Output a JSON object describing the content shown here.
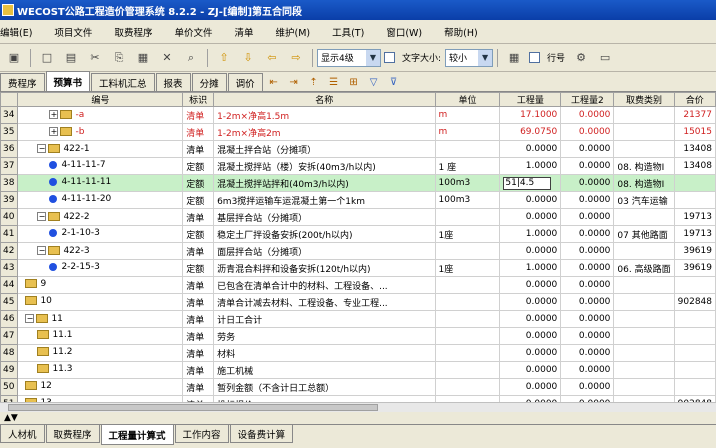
{
  "window": {
    "title": "WECOST公路工程造价管理系统 8.2.2 - ZJ-[编制]第五合同段"
  },
  "menu": [
    "编辑(E)",
    "项目文件",
    "取费程序",
    "单价文件",
    "清单",
    "维护(M)",
    "工具(T)",
    "窗口(W)",
    "帮助(H)"
  ],
  "toolbar": {
    "display_level": "显示4级",
    "font_size_label": "文字大小:",
    "font_size_value": "较小",
    "line_number_label": "行号"
  },
  "tabs": [
    "费程序",
    "预算书",
    "工料机汇总",
    "报表",
    "分摊",
    "调价"
  ],
  "active_tab": 1,
  "columns": [
    "编号",
    "标识",
    "名称",
    "单位",
    "工程量",
    "工程量2",
    "取费类别",
    "合价"
  ],
  "rows": [
    {
      "rn": "34",
      "code": "-a",
      "level": 2,
      "kind": "folder",
      "pm": "+",
      "tag": "清单",
      "name": "1-2m×净高1.5m",
      "unit": "m",
      "qty": "17.1000",
      "qty2": "0.0000",
      "cat": "",
      "total": "21377",
      "red": true
    },
    {
      "rn": "35",
      "code": "-b",
      "level": 2,
      "kind": "folder",
      "pm": "+",
      "tag": "清单",
      "name": "1-2m×净高2m",
      "unit": "m",
      "qty": "69.0750",
      "qty2": "0.0000",
      "cat": "",
      "total": "15015",
      "red": true
    },
    {
      "rn": "36",
      "code": "422-1",
      "level": 1,
      "kind": "folder",
      "pm": "-",
      "tag": "清单",
      "name": "混凝土拌合站（分摊项）",
      "unit": "",
      "qty": "0.0000",
      "qty2": "0.0000",
      "cat": "",
      "total": "13408"
    },
    {
      "rn": "37",
      "code": "4-11-11-7",
      "level": 2,
      "kind": "dot",
      "pm": "",
      "tag": "定额",
      "name": "混凝土搅拌站（楼）安拆(40m3/h以内)",
      "unit": "1 座",
      "qty": "1.0000",
      "qty2": "0.0000",
      "cat": "08. 构造物Ⅰ",
      "total": "13408"
    },
    {
      "rn": "38",
      "code": "4-11-11-11",
      "level": 2,
      "kind": "dot",
      "pm": "",
      "tag": "定额",
      "name": "混凝土搅拌站拌和(40m3/h以内)",
      "unit": "100m3",
      "qty": "",
      "qty_edit": "51|4.5",
      "qty2": "0.0000",
      "cat": "08. 构造物Ⅰ",
      "total": "",
      "selected": true
    },
    {
      "rn": "39",
      "code": "4-11-11-20",
      "level": 2,
      "kind": "dot",
      "pm": "",
      "tag": "定额",
      "name": "6m3搅拌运输车运混凝土第一个1km",
      "unit": "100m3",
      "qty": "0.0000",
      "qty2": "0.0000",
      "cat": "03 汽车运输",
      "total": ""
    },
    {
      "rn": "40",
      "code": "422-2",
      "level": 1,
      "kind": "folder",
      "pm": "-",
      "tag": "清单",
      "name": "基层拌合站（分摊项）",
      "unit": "",
      "qty": "0.0000",
      "qty2": "0.0000",
      "cat": "",
      "total": "19713"
    },
    {
      "rn": "41",
      "code": "2-1-10-3",
      "level": 2,
      "kind": "dot",
      "pm": "",
      "tag": "定额",
      "name": "稳定土厂拌设备安拆(200t/h以内)",
      "unit": "1座",
      "qty": "1.0000",
      "qty2": "0.0000",
      "cat": "07 其他路面",
      "total": "19713"
    },
    {
      "rn": "42",
      "code": "422-3",
      "level": 1,
      "kind": "folder",
      "pm": "-",
      "tag": "清单",
      "name": "面层拌合站（分摊项）",
      "unit": "",
      "qty": "0.0000",
      "qty2": "0.0000",
      "cat": "",
      "total": "39619"
    },
    {
      "rn": "43",
      "code": "2-2-15-3",
      "level": 2,
      "kind": "dot",
      "pm": "",
      "tag": "定额",
      "name": "沥青混合料拌和设备安拆(120t/h以内)",
      "unit": "1座",
      "qty": "1.0000",
      "qty2": "0.0000",
      "cat": "06. 高级路面",
      "total": "39619"
    },
    {
      "rn": "44",
      "code": "9",
      "level": 0,
      "kind": "folder",
      "pm": "",
      "tag": "清单",
      "name": "已包含在清单合计中的材料、工程设备、...",
      "unit": "",
      "qty": "0.0000",
      "qty2": "0.0000",
      "cat": "",
      "total": ""
    },
    {
      "rn": "45",
      "code": "10",
      "level": 0,
      "kind": "folder",
      "pm": "",
      "tag": "清单",
      "name": "清单合计减去材料、工程设备、专业工程...",
      "unit": "",
      "qty": "0.0000",
      "qty2": "0.0000",
      "cat": "",
      "total": "902848"
    },
    {
      "rn": "46",
      "code": "11",
      "level": 0,
      "kind": "folder",
      "pm": "-",
      "tag": "清单",
      "name": "计日工合计",
      "unit": "",
      "qty": "0.0000",
      "qty2": "0.0000",
      "cat": "",
      "total": ""
    },
    {
      "rn": "47",
      "code": "11.1",
      "level": 1,
      "kind": "folder",
      "pm": "",
      "tag": "清单",
      "name": "劳务",
      "unit": "",
      "qty": "0.0000",
      "qty2": "0.0000",
      "cat": "",
      "total": ""
    },
    {
      "rn": "48",
      "code": "11.2",
      "level": 1,
      "kind": "folder",
      "pm": "",
      "tag": "清单",
      "name": "材料",
      "unit": "",
      "qty": "0.0000",
      "qty2": "0.0000",
      "cat": "",
      "total": ""
    },
    {
      "rn": "49",
      "code": "11.3",
      "level": 1,
      "kind": "folder",
      "pm": "",
      "tag": "清单",
      "name": "施工机械",
      "unit": "",
      "qty": "0.0000",
      "qty2": "0.0000",
      "cat": "",
      "total": ""
    },
    {
      "rn": "50",
      "code": "12",
      "level": 0,
      "kind": "folder",
      "pm": "",
      "tag": "清单",
      "name": "暂列金额（不含计日工总额）",
      "unit": "",
      "qty": "0.0000",
      "qty2": "0.0000",
      "cat": "",
      "total": ""
    },
    {
      "rn": "51",
      "code": "13",
      "level": 0,
      "kind": "folder",
      "pm": "",
      "tag": "清单",
      "name": "投标报价",
      "unit": "",
      "qty": "0.0000",
      "qty2": "0.0000",
      "cat": "",
      "total": "902848"
    }
  ],
  "bottom_tabs": [
    "人材机",
    "取费程序",
    "工程量计算式",
    "工作内容",
    "设备费计算"
  ],
  "bottom_active": 2
}
